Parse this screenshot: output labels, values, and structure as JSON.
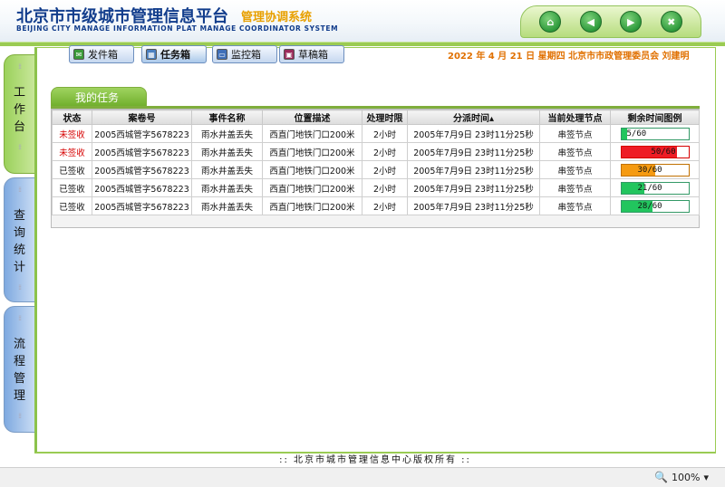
{
  "header": {
    "title": "北京市市级城市管理信息平台",
    "subtitle": "管理协调系统",
    "english": "BEIJING CITY MANAGE INFORMATION PLAT MANAGE COORDINATOR SYSTEM",
    "controls": [
      {
        "name": "home-icon",
        "glyph": "⌂"
      },
      {
        "name": "back-icon",
        "glyph": "◀"
      },
      {
        "name": "forward-icon",
        "glyph": "▶"
      },
      {
        "name": "close-icon",
        "glyph": "✖"
      }
    ]
  },
  "toolbar": {
    "outbox": "发件箱",
    "tasks": "任务箱",
    "monitor": "监控箱",
    "drafts": "草稿箱"
  },
  "date_line": "2022 年 4 月 21 日 星期四   北京市市政管理委员会 刘建明",
  "left_tabs": {
    "work": "工作台",
    "query": "查询统计",
    "flow": "流程管理"
  },
  "section_title": "我的任务",
  "table": {
    "columns": [
      "状态",
      "案卷号",
      "事件名称",
      "位置描述",
      "处理时限",
      "分派时间▴",
      "当前处理节点",
      "剩余时间图例"
    ],
    "rows": [
      {
        "status": "未签收",
        "status_color": "#d60000",
        "case": "2005西城管字5678223",
        "event": "雨水井盖丢失",
        "location": "西直门地铁门口200米",
        "limit": "2小时",
        "time": "2005年7月9日  23时11分25秒",
        "node": "串签节点",
        "remain_label": "5/60",
        "remain": 5,
        "total": 60,
        "bar_color": "#22c55e",
        "border_color": "#339966"
      },
      {
        "status": "未签收",
        "status_color": "#d60000",
        "case": "2005西城管字5678223",
        "event": "雨水井盖丢失",
        "location": "西直门地铁门口200米",
        "limit": "2小时",
        "time": "2005年7月9日  23时11分25秒",
        "node": "串签节点",
        "remain_label": "50/60",
        "remain": 50,
        "total": 60,
        "bar_color": "#ee1c25",
        "border_color": "#d60000"
      },
      {
        "status": "已签收",
        "status_color": "#111111",
        "case": "2005西城管字5678223",
        "event": "雨水井盖丢失",
        "location": "西直门地铁门口200米",
        "limit": "2小时",
        "time": "2005年7月9日  23时11分25秒",
        "node": "串签节点",
        "remain_label": "30/60",
        "remain": 30,
        "total": 60,
        "bar_color": "#f59a11",
        "border_color": "#c07000"
      },
      {
        "status": "已签收",
        "status_color": "#111111",
        "case": "2005西城管字5678223",
        "event": "雨水井盖丢失",
        "location": "西直门地铁门口200米",
        "limit": "2小时",
        "time": "2005年7月9日  23时11分25秒",
        "node": "串签节点",
        "remain_label": "21/60",
        "remain": 21,
        "total": 60,
        "bar_color": "#22c55e",
        "border_color": "#339966"
      },
      {
        "status": "已签收",
        "status_color": "#111111",
        "case": "2005西城管字5678223",
        "event": "雨水井盖丢失",
        "location": "西直门地铁门口200米",
        "limit": "2小时",
        "time": "2005年7月9日  23时11分25秒",
        "node": "串签节点",
        "remain_label": "28/60",
        "remain": 28,
        "total": 60,
        "bar_color": "#22c55e",
        "border_color": "#339966"
      }
    ]
  },
  "footer": "::  北京市城市管理信息中心版权所有  ::",
  "statusbar": {
    "zoom": "100%"
  }
}
